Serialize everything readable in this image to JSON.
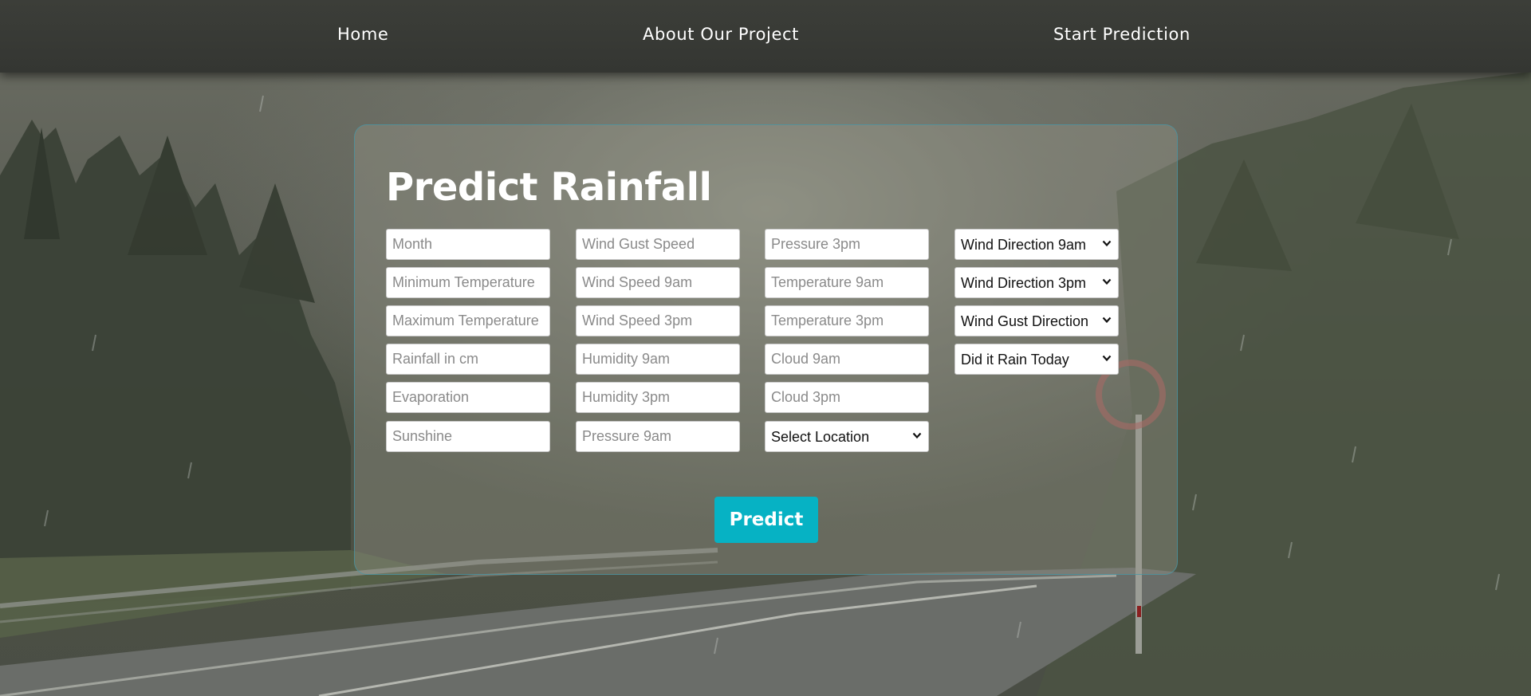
{
  "nav": {
    "home": "Home",
    "about": "About Our Project",
    "start": "Start Prediction"
  },
  "form": {
    "title": "Predict Rainfall",
    "inputs": [
      "Month",
      "Minimum Temperature",
      "Maximum Temperature",
      "Rainfall in cm",
      "Evaporation",
      "Sunshine",
      "Wind Gust Speed",
      "Wind Speed 9am",
      "Wind Speed 3pm",
      "Humidity 9am",
      "Humidity 3pm",
      "Pressure 9am",
      "Pressure 3pm",
      "Temperature 9am",
      "Temperature 3pm",
      "Cloud 9am",
      "Cloud 3pm"
    ],
    "selects": [
      "Select Location",
      "Wind Direction 9am",
      "Wind Direction 3pm",
      "Wind Gust Direction",
      "Did it Rain Today"
    ],
    "submit_label": "Predict"
  },
  "colors": {
    "accent": "#06b2c4",
    "nav_bg": "#3a3c37",
    "card_border": "#4696a5"
  },
  "icons": {
    "select_arrow": "chevron-down-icon"
  }
}
